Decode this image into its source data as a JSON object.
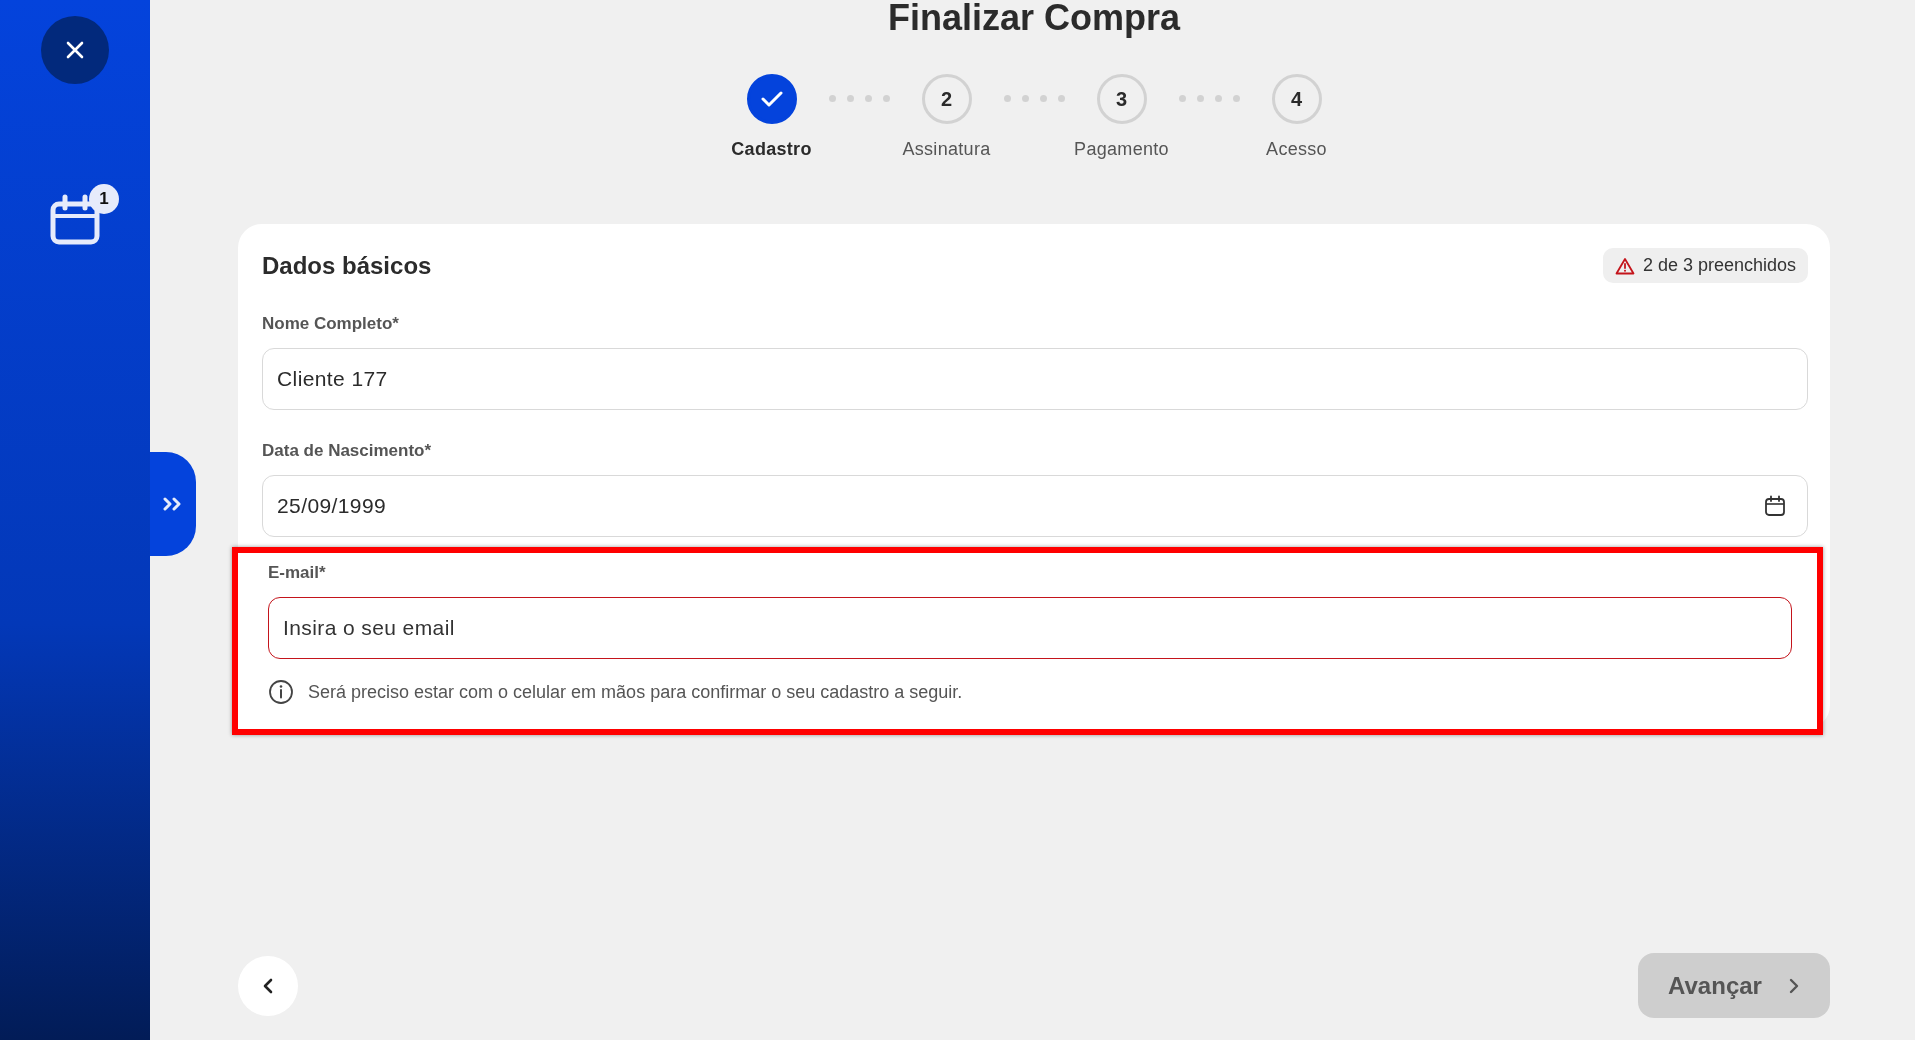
{
  "sidebar": {
    "calendar_badge": "1"
  },
  "title": "Finalizar Compra",
  "steps": [
    {
      "label": "Cadastro",
      "completed": true,
      "selected": true
    },
    {
      "label": "Assinatura",
      "number": "2",
      "completed": false,
      "selected": false
    },
    {
      "label": "Pagamento",
      "number": "3",
      "completed": false,
      "selected": false
    },
    {
      "label": "Acesso",
      "number": "4",
      "completed": false,
      "selected": false
    }
  ],
  "card": {
    "title": "Dados básicos",
    "progress": "2 de 3 preenchidos",
    "fields": [
      {
        "kind": "text",
        "label": "Nome Completo*",
        "value": "Cliente 177",
        "invalid": false
      },
      {
        "kind": "date",
        "label": "Data de Nascimento*",
        "value": "25/09/1999",
        "invalid": false
      },
      {
        "kind": "text",
        "label": "E-mail*",
        "placeholder": "Insira o seu email",
        "invalid": true,
        "highlighted": true,
        "note": "Será preciso estar com o celular em mãos para confirmar o seu cadastro a seguir."
      }
    ]
  },
  "next_button": {
    "label": "Avançar",
    "disabled": true
  }
}
